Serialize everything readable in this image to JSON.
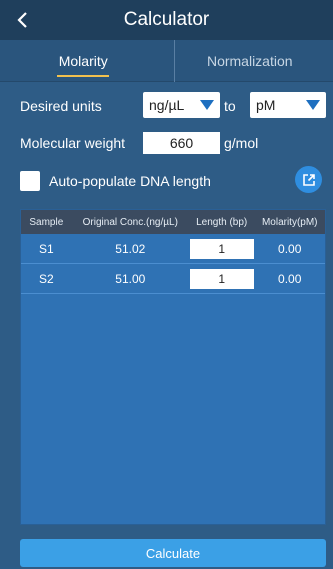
{
  "header": {
    "title": "Calculator",
    "back_icon": "chevron-left-icon"
  },
  "tabs": [
    {
      "label": "Molarity",
      "active": true
    },
    {
      "label": "Normalization",
      "active": false
    }
  ],
  "units": {
    "label": "Desired units",
    "from_value": "ng/µL",
    "to_label": "to",
    "to_value": "pM"
  },
  "molecular_weight": {
    "label": "Molecular weight",
    "value": "660",
    "unit": "g/mol"
  },
  "auto_populate": {
    "label": "Auto-populate DNA length",
    "checked": false
  },
  "table": {
    "headers": [
      "Sample",
      "Original Conc.(ng/µL)",
      "Length (bp)",
      "Molarity(pM)"
    ],
    "rows": [
      {
        "sample": "S1",
        "conc": "51.02",
        "length": "1",
        "molarity": "0.00"
      },
      {
        "sample": "S2",
        "conc": "51.00",
        "length": "1",
        "molarity": "0.00"
      }
    ]
  },
  "actions": {
    "calculate_label": "Calculate"
  },
  "colors": {
    "background": "#2e5c86",
    "titlebar": "#1f3f5c",
    "accent": "#3ba0e6",
    "tab_underline": "#f2c14e"
  }
}
